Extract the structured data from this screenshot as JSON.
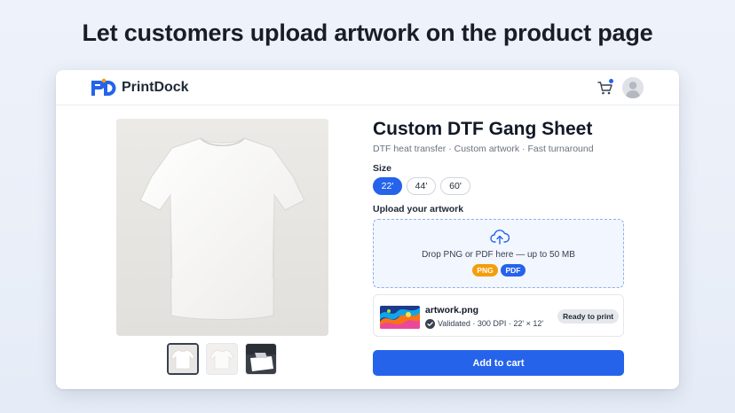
{
  "headline": "Let customers upload artwork on the product page",
  "nav": {
    "brand": "PrintDock",
    "logo_icon": "printdock-logo-icon",
    "cart_icon": "cart-icon",
    "avatar_icon": "user-avatar-icon",
    "accent": "#2563eb"
  },
  "gallery": {
    "main_image": "white-tshirt-image",
    "thumbnails": [
      "thumbnail-tshirt-front",
      "thumbnail-tshirt-flat",
      "thumbnail-tshirt-printer"
    ],
    "active_index": 0
  },
  "product": {
    "title": "Custom DTF Gang Sheet",
    "subtitle": "DTF heat transfer · Custom artwork · Fast turnaround"
  },
  "size": {
    "label": "Size",
    "options": [
      "22'",
      "44'",
      "60'"
    ],
    "selected": "22'"
  },
  "upload": {
    "label": "Upload your artwork",
    "drop_text": "Drop PNG or PDF here — up to 50 MB",
    "upload_icon": "upload-cloud-icon",
    "formats": [
      {
        "label": "PNG",
        "color": "#f59e0b"
      },
      {
        "label": "PDF",
        "color": "#2563eb"
      }
    ]
  },
  "file": {
    "name": "artwork.png",
    "meta": "Validated · 300 DPI · 22' × 12'",
    "check_icon": "check-circle-icon",
    "status": "Ready to print"
  },
  "cta": {
    "label": "Add to cart"
  }
}
